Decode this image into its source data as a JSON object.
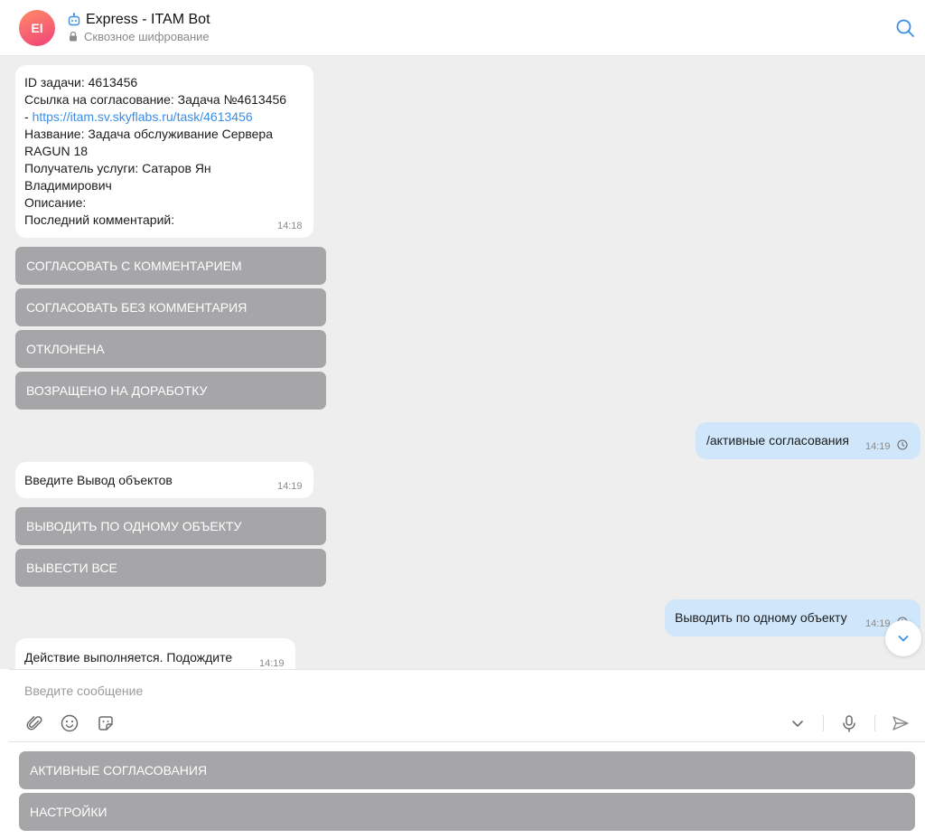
{
  "header": {
    "avatar_initials": "EI",
    "title": "Express - ITAM Bot",
    "subtitle": "Сквозное шифрование"
  },
  "messages": [
    {
      "direction": "in",
      "lines": {
        "task_id": "ID задачи: 4613456",
        "approval_link_label": "Ссылка на согласование: Задача №4613456",
        "approval_link_prefix": "- ",
        "approval_link_url": "https://itam.sv.skyflabs.ru/task/4613456",
        "name_1": "Название: Задача обслуживание Сервера",
        "name_2": "RAGUN 18",
        "recipient_1": "Получатель услуги: Сатаров Ян",
        "recipient_2": "Владимирович",
        "description": "Описание:",
        "last_comment": "Последний комментарий:"
      },
      "time": "14:18",
      "buttons": [
        "СОГЛАСОВАТЬ С КОММЕНТАРИЕМ",
        "СОГЛАСОВАТЬ БЕЗ КОММЕНТАРИЯ",
        "ОТКЛОНЕНА",
        "ВОЗРАЩЕНО НА ДОРАБОТКУ"
      ]
    },
    {
      "direction": "out",
      "text": "/активные согласования",
      "time": "14:19"
    },
    {
      "direction": "in",
      "text": "Введите Вывод объектов",
      "time": "14:19",
      "buttons": [
        "ВЫВОДИТЬ ПО ОДНОМУ ОБЪЕКТУ",
        "ВЫВЕСТИ ВСЕ"
      ]
    },
    {
      "direction": "out",
      "text": "Выводить по одному объекту",
      "time": "14:19"
    },
    {
      "direction": "in",
      "text": "Действие выполняется. Подождите",
      "time": "14:19"
    }
  ],
  "composer": {
    "placeholder": "Введите сообщение"
  },
  "bot_keyboard": [
    "АКТИВНЫЕ СОГЛАСОВАНИЯ",
    "НАСТРОЙКИ"
  ],
  "colors": {
    "accent": "#3a8ee6",
    "outgoing_bubble": "#cfe6fb",
    "keyboard_button": "#a6a6a8",
    "chat_background": "#eeeeef"
  }
}
